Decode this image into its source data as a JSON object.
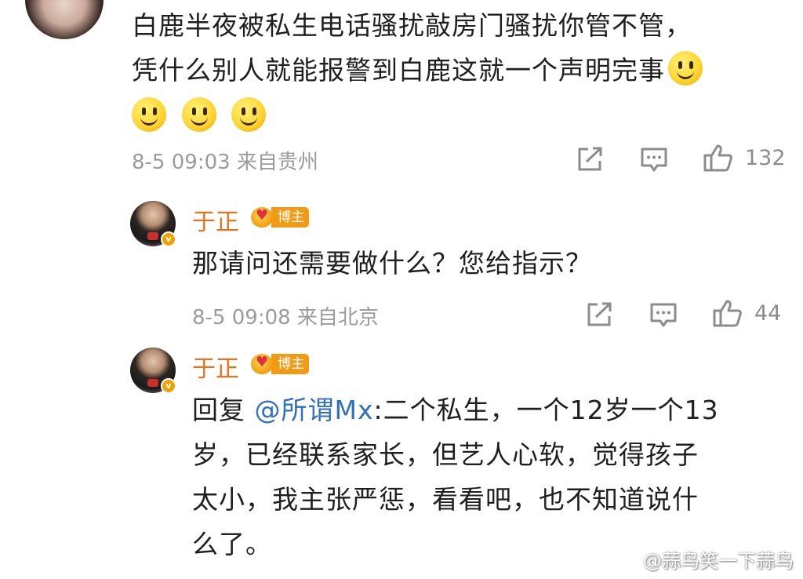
{
  "comment1": {
    "lines": [
      "白鹿半夜被私生电话骚扰敲房门骚扰你管不管，",
      "凭什么别人就能报警到白鹿这就一个声明完事"
    ],
    "emoji": "smile-emoji",
    "meta": "8-5 09:03 来自贵州",
    "likes": "132"
  },
  "reply1": {
    "author": "于正",
    "badge": "博主",
    "text": "那请问还需要做什么？您给指示？",
    "meta": "8-5 09:08 来自北京",
    "likes": "44"
  },
  "reply2": {
    "author": "于正",
    "badge": "博主",
    "prefix": "回复",
    "mention": "@所谓Mx",
    "line1_rest": ":二个私生，一个12岁一个13",
    "line2": "岁，已经联系家长，但艺人心软，觉得孩子",
    "line3": "太小，我主张严惩，看看吧，也不知道说什",
    "line4": "么了。"
  },
  "watermark": "@蒜鸟笑一下蒜鸟",
  "icons": {
    "share": "share-icon",
    "comment": "comment-icon",
    "like": "thumbs-up-icon",
    "verified": "verified-icon"
  }
}
